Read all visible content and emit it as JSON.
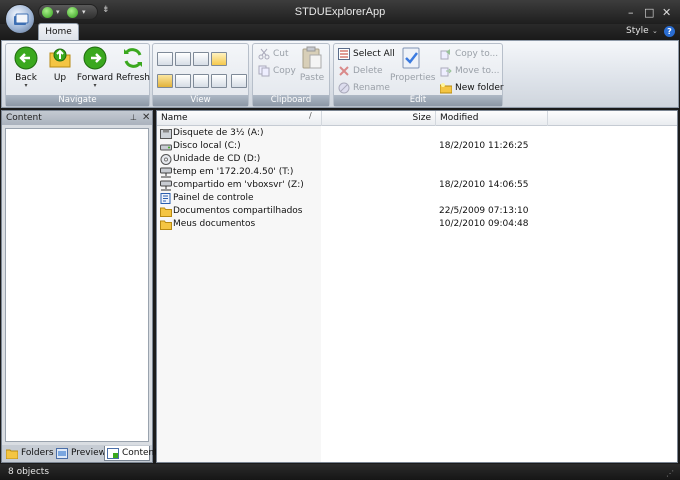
{
  "app": {
    "title": "STDUExplorerApp"
  },
  "tabs": [
    {
      "label": "Home"
    }
  ],
  "style_menu": {
    "label": "Style"
  },
  "ribbon": {
    "navigate": {
      "label": "Navigate",
      "back": "Back",
      "up": "Up",
      "forward": "Forward",
      "refresh": "Refresh"
    },
    "view": {
      "label": "View"
    },
    "clipboard": {
      "label": "Clipboard",
      "cut": "Cut",
      "copy": "Copy",
      "paste": "Paste"
    },
    "edit": {
      "label": "Edit",
      "select_all": "Select All",
      "delete": "Delete",
      "rename": "Rename",
      "properties": "Properties",
      "copy_to": "Copy to...",
      "move_to": "Move to...",
      "new_folder": "New folder"
    }
  },
  "left_panel": {
    "title": "Content",
    "tabs": [
      "Folders",
      "Preview",
      "Content"
    ]
  },
  "file_list": {
    "columns": {
      "name": "Name",
      "size": "Size",
      "modified": "Modified"
    },
    "items": [
      {
        "name": "Disquete de 3½ (A:)",
        "size": "",
        "modified": "",
        "icon": "floppy-drive"
      },
      {
        "name": "Disco local (C:)",
        "size": "",
        "modified": "18/2/2010 11:26:25",
        "icon": "hard-drive"
      },
      {
        "name": "Unidade de CD (D:)",
        "size": "",
        "modified": "",
        "icon": "cd-drive"
      },
      {
        "name": "temp em '172.20.4.50' (T:)",
        "size": "",
        "modified": "",
        "icon": "network-drive"
      },
      {
        "name": "compartido em 'vboxsvr' (Z:)",
        "size": "",
        "modified": "18/2/2010 14:06:55",
        "icon": "network-drive"
      },
      {
        "name": "Painel de controle",
        "size": "",
        "modified": "",
        "icon": "control-panel"
      },
      {
        "name": "Documentos compartilhados",
        "size": "",
        "modified": "22/5/2009 07:13:10",
        "icon": "folder"
      },
      {
        "name": "Meus documentos",
        "size": "",
        "modified": "10/2/2010 09:04:48",
        "icon": "folder"
      }
    ]
  },
  "status": {
    "text": "8 objects"
  }
}
